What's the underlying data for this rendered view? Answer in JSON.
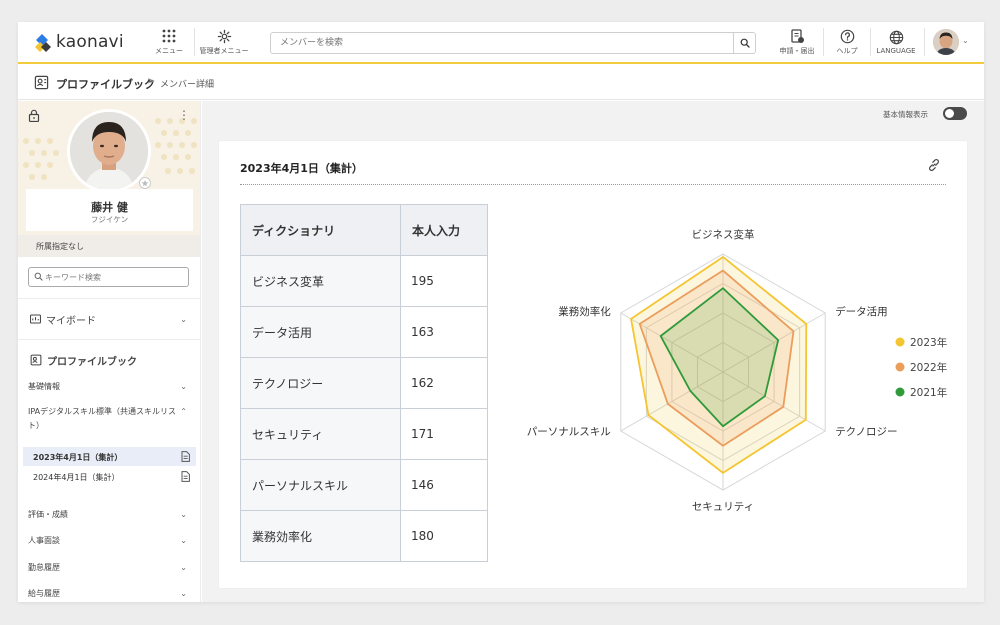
{
  "header": {
    "logo_text": "kaonavi",
    "menu_label": "メニュー",
    "admin_menu_label": "管理者メニュー",
    "search_placeholder": "メンバーを検索",
    "apply_label": "申請・届出",
    "help_label": "ヘルプ",
    "language_label": "LANGUAGE",
    "colors": {
      "accent": "#f2cc3c"
    }
  },
  "breadcrumb": {
    "root": "プロファイルブック",
    "separator": ">",
    "current": "メンバー詳細"
  },
  "profile": {
    "name": "藤井 健",
    "kana": "フジイケン",
    "affiliation": "所属指定なし"
  },
  "sidebar": {
    "keyword_placeholder": "キーワード検索",
    "mypage_label": "マイボード",
    "profilebook_label": "プロファイルブック",
    "sections": [
      {
        "label": "基礎情報"
      },
      {
        "label": "IPAデジタルスキル標準（共通スキルリスト）"
      },
      {
        "label": "評価・成績"
      },
      {
        "label": "人事面談"
      },
      {
        "label": "勤怠履歴"
      },
      {
        "label": "給与履歴"
      }
    ],
    "ipa_subitems": [
      {
        "label": "2023年4月1日（集計）",
        "active": true
      },
      {
        "label": "2024年4月1日（集計）",
        "active": false
      }
    ]
  },
  "main": {
    "toggle_label": "基本情報表示",
    "toggle_on": false,
    "card_title": "2023年4月1日（集計）",
    "table": {
      "headers": [
        "ディクショナリ",
        "本人入力"
      ],
      "rows": [
        [
          "ビジネス変革",
          "195"
        ],
        [
          "データ活用",
          "163"
        ],
        [
          "テクノロジー",
          "162"
        ],
        [
          "セキュリティ",
          "171"
        ],
        [
          "パーソナルスキル",
          "146"
        ],
        [
          "業務効率化",
          "180"
        ]
      ]
    }
  },
  "chart_data": {
    "type": "radar",
    "categories": [
      "ビジネス変革",
      "データ活用",
      "テクノロジー",
      "セキュリティ",
      "パーソナルスキル",
      "業務効率化"
    ],
    "rmax": 200,
    "rings": 4,
    "series": [
      {
        "name": "2023年",
        "color": "#f4c531",
        "values": [
          195,
          163,
          162,
          171,
          146,
          180
        ]
      },
      {
        "name": "2022年",
        "color": "#eb9d5c",
        "values": [
          172,
          138,
          118,
          125,
          108,
          163
        ]
      },
      {
        "name": "2021年",
        "color": "#2f9a3a",
        "values": [
          142,
          108,
          82,
          92,
          64,
          122
        ]
      }
    ],
    "legend_position": "right"
  }
}
